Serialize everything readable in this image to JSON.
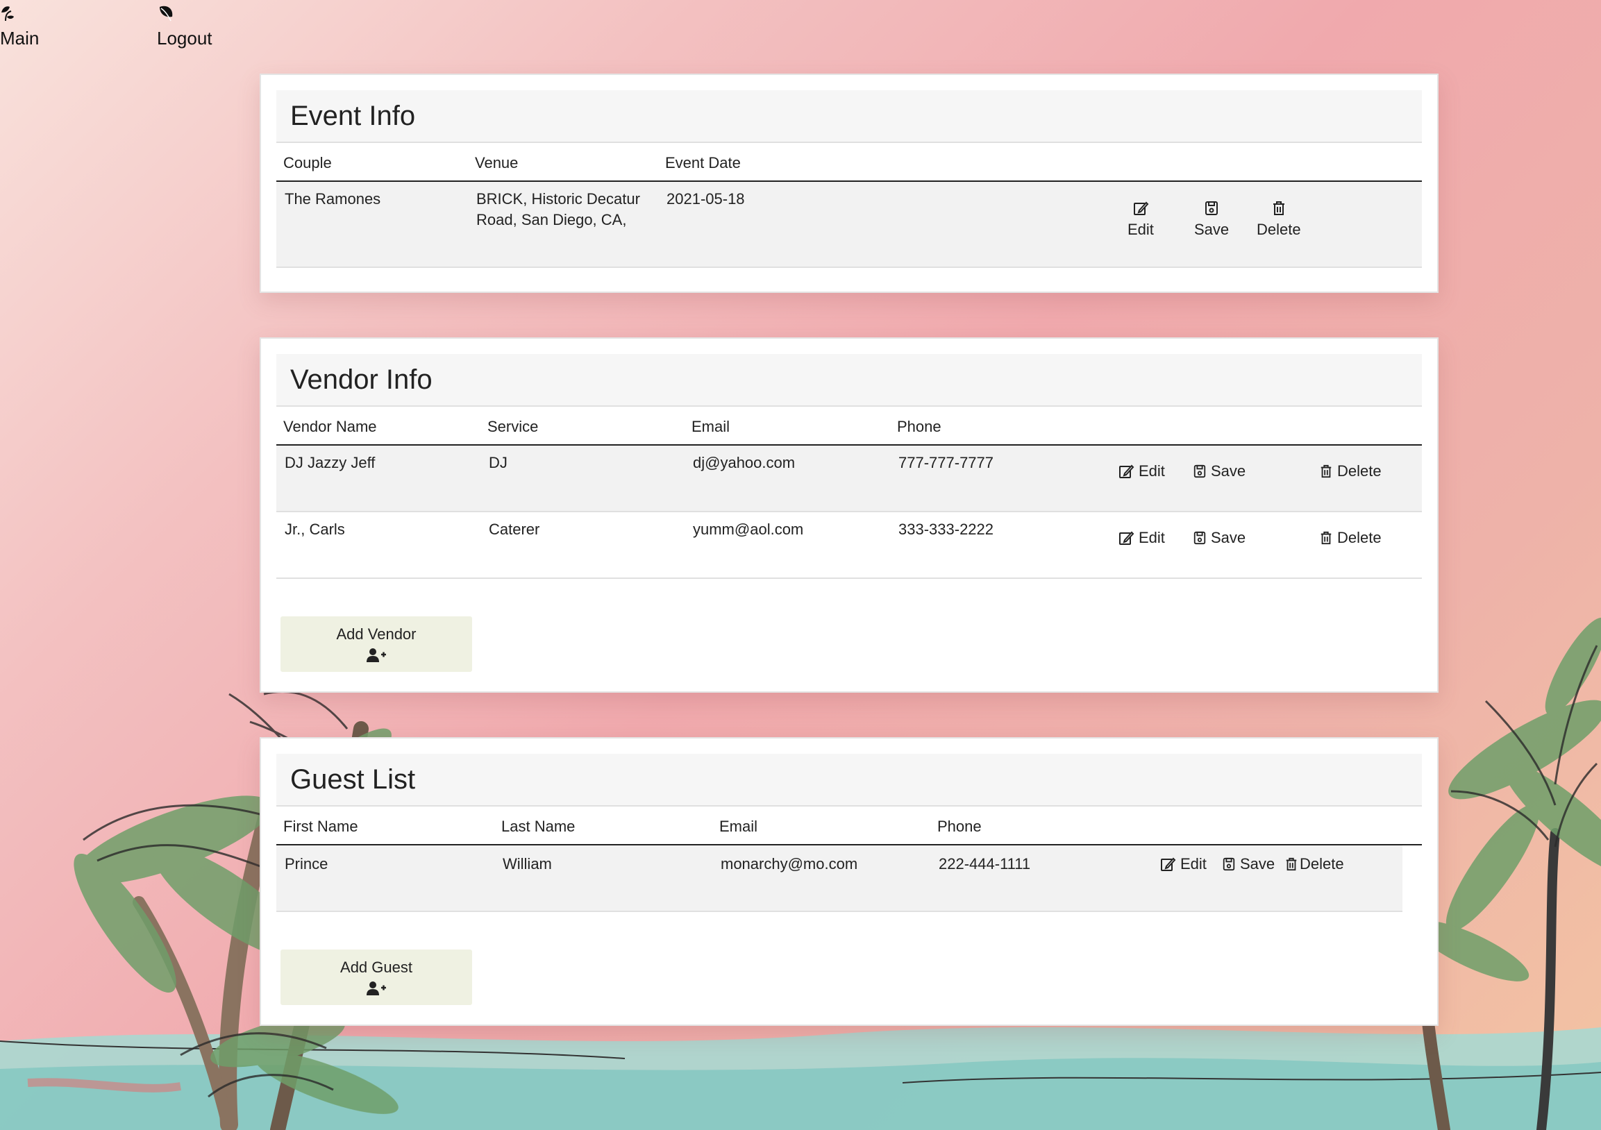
{
  "nav": {
    "main_label": "Main",
    "logout_label": "Logout"
  },
  "event": {
    "title": "Event Info",
    "columns": [
      "Couple",
      "Venue",
      "Event Date"
    ],
    "rows": [
      {
        "couple": "The Ramones",
        "venue_line1": "BRICK, Historic Decatur",
        "venue_line2": "Road, San Diego, CA,",
        "date": "2021-05-18"
      }
    ],
    "actions": {
      "edit": "Edit",
      "save": "Save",
      "delete": "Delete"
    }
  },
  "vendors": {
    "title": "Vendor Info",
    "columns": [
      "Vendor Name",
      "Service",
      "Email",
      "Phone"
    ],
    "rows": [
      {
        "name": "DJ Jazzy Jeff",
        "service": "DJ",
        "email": "dj@yahoo.com",
        "phone": "777-777-7777"
      },
      {
        "name": "Jr., Carls",
        "service": "Caterer",
        "email": "yumm@aol.com",
        "phone": "333-333-2222"
      }
    ],
    "actions": {
      "edit": "Edit",
      "save": "Save",
      "delete": "Delete"
    },
    "add_label": "Add Vendor"
  },
  "guests": {
    "title": "Guest List",
    "columns": [
      "First Name",
      "Last Name",
      "Email",
      "Phone"
    ],
    "rows": [
      {
        "first": "Prince",
        "last": "William",
        "email": "monarchy@mo.com",
        "phone": "222-444-1111"
      }
    ],
    "actions": {
      "edit": "Edit",
      "save": "Save",
      "delete": "Delete"
    },
    "add_label": "Add Guest"
  },
  "colors": {
    "background_start": "#f9e2dc",
    "background_mid": "#f0a9ad",
    "background_end": "#f3c4a2",
    "add_button": "#eff1e2",
    "sea": "#8fcfc8",
    "palm_leaf": "#6f9f6a"
  }
}
